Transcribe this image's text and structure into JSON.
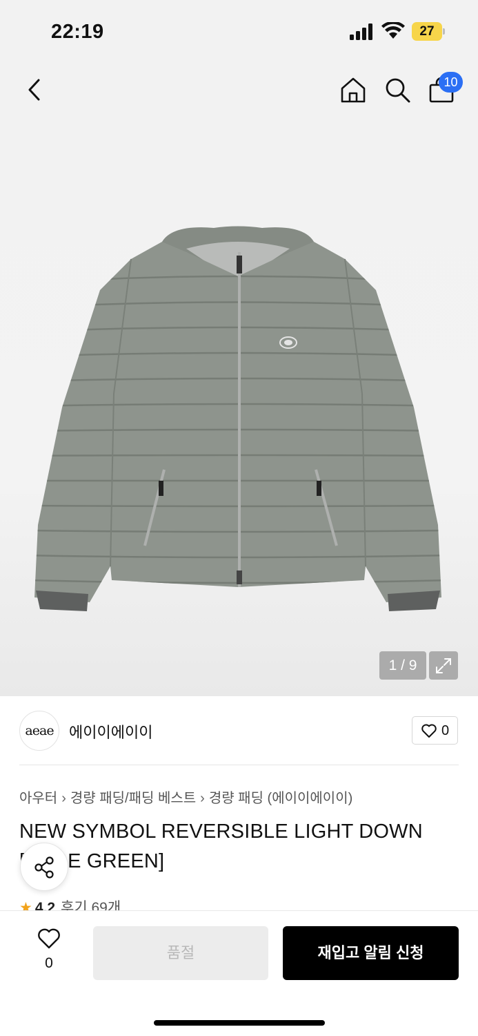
{
  "status_bar": {
    "time": "22:19",
    "battery_level": "27",
    "icons": [
      "signal-icon",
      "wifi-icon",
      "battery-icon"
    ],
    "battery_color": "#f7d54a"
  },
  "nav": {
    "icons": [
      "back-icon",
      "home-icon",
      "search-icon",
      "shopping-bag-icon"
    ],
    "cart_count": "10",
    "badge_color": "#2b6ff4"
  },
  "gallery": {
    "counter": "1 / 9",
    "expand_icon": "expand-icon",
    "product_color": "#8e948d"
  },
  "brand": {
    "logo_text": "aeae",
    "name": "에이이에이이",
    "like_count": "0"
  },
  "breadcrumb": {
    "items": [
      "아우터",
      "경량 패딩/패딩 베스트",
      "경량 패딩 (에이이에이이)"
    ]
  },
  "product": {
    "title": "NEW SYMBOL REVERSIBLE LIGHT DOWN [SAGE GREEN]",
    "rating": "4.2",
    "reviews": "후기 69개",
    "share_icon": "share-icon"
  },
  "purchase_bar": {
    "wish_count": "0",
    "sold_out_label": "품절",
    "restock_label": "재입고 알림 신청",
    "primary_color": "#000000"
  }
}
